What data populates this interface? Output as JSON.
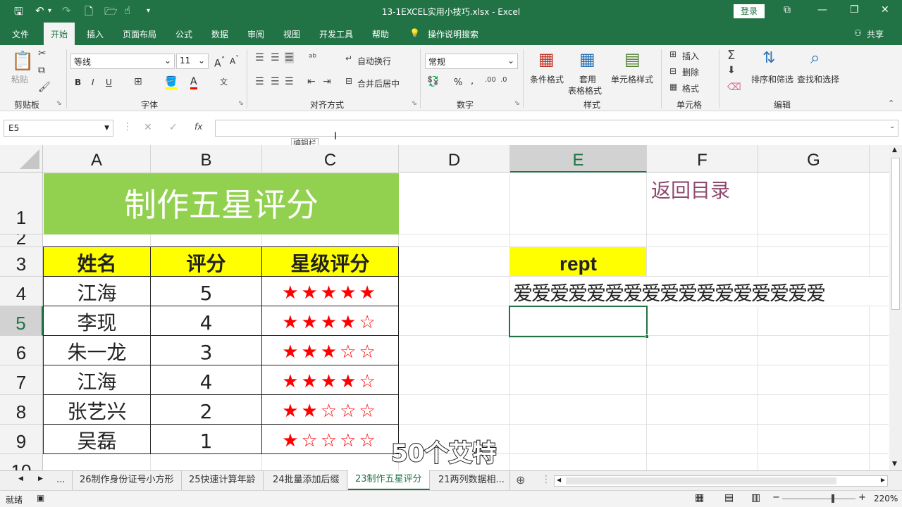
{
  "window": {
    "title": "13-1EXCEL实用小技巧.xlsx  -  Excel",
    "login": "登录"
  },
  "tabs": [
    "文件",
    "开始",
    "插入",
    "页面布局",
    "公式",
    "数据",
    "审阅",
    "视图",
    "开发工具",
    "帮助"
  ],
  "tell_me": "操作说明搜索",
  "share": "共享",
  "ribbon": {
    "groups": {
      "clipboard": "剪贴板",
      "font": "字体",
      "align": "对齐方式",
      "number": "数字",
      "styles": "样式",
      "cells": "单元格",
      "editing": "编辑"
    },
    "paste": "粘贴",
    "font_name": "等线",
    "font_size": "11",
    "wrap": "自动换行",
    "merge": "合并后居中",
    "number_format": "常规",
    "cond_format": "条件格式",
    "table_format_1": "套用",
    "table_format_2": "表格格式",
    "cell_styles": "单元格样式",
    "insert": "插入",
    "delete": "删除",
    "format": "格式",
    "sort_filter": "排序和筛选",
    "find_select": "查找和选择",
    "bold": "B",
    "italic": "I",
    "underline": "U",
    "percent": "%",
    "comma": ","
  },
  "formula_bar": {
    "name_box": "E5",
    "tooltip": "编辑栏",
    "fx": "fx",
    "value": ""
  },
  "columns": [
    "A",
    "B",
    "C",
    "D",
    "E",
    "F",
    "G"
  ],
  "rows": [
    "1",
    "2",
    "3",
    "4",
    "5",
    "6",
    "7",
    "8",
    "9",
    "10"
  ],
  "sheet": {
    "title": "制作五星评分",
    "link": "返回目录",
    "headers": [
      "姓名",
      "评分",
      "星级评分"
    ],
    "records": [
      {
        "name": "江海",
        "score": "5",
        "stars": "★★★★★"
      },
      {
        "name": "李现",
        "score": "4",
        "stars": "★★★★☆"
      },
      {
        "name": "朱一龙",
        "score": "3",
        "stars": "★★★☆☆"
      },
      {
        "name": "江海",
        "score": "4",
        "stars": "★★★★☆"
      },
      {
        "name": "张艺兴",
        "score": "2",
        "stars": "★★☆☆☆"
      },
      {
        "name": "吴磊",
        "score": "1",
        "stars": "★☆☆☆☆"
      }
    ],
    "rept_label": "rept",
    "rept_output": "爱爱爱爱爱爱爱爱爱爱爱爱爱爱爱爱爱"
  },
  "sheet_tabs": [
    "...",
    "26制作身份证号小方形",
    "25快速计算年龄",
    "24批量添加后缀",
    "23制作五星评分",
    "21两列数据相..."
  ],
  "status": {
    "ready": "就绪",
    "zoom": "220%"
  },
  "subtitle": "50个艾特",
  "colors": {
    "excel_green": "#217346",
    "title_fill": "#92d050",
    "header_fill": "#ffff00",
    "star": "#ff0000",
    "link": "#8e4a6e"
  }
}
